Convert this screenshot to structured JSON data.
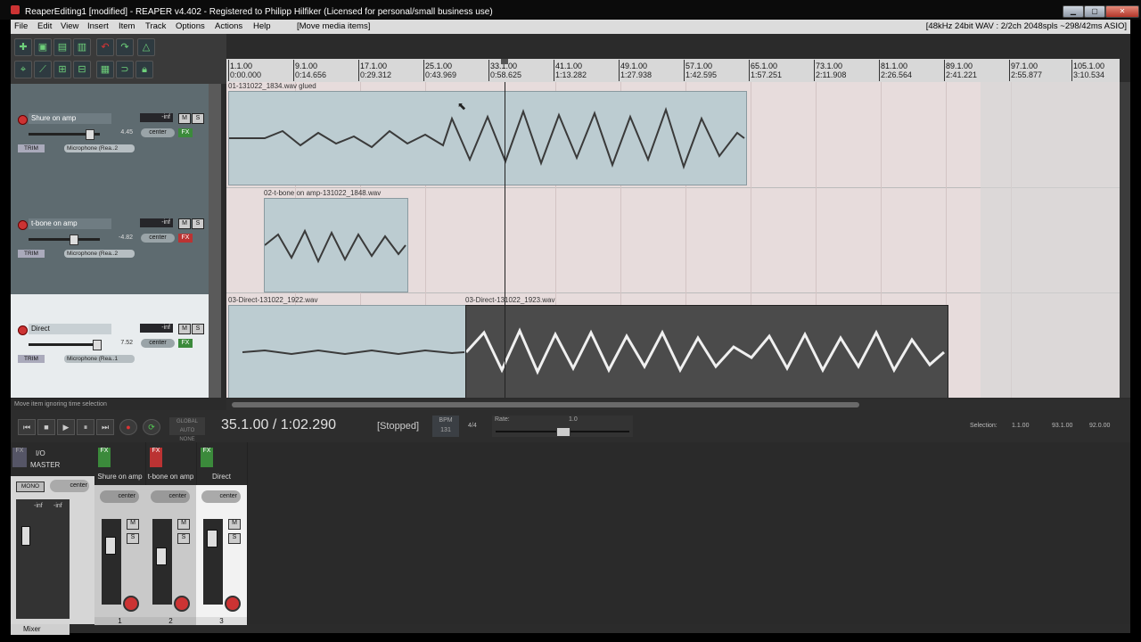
{
  "window": {
    "title": "ReaperEditing1 [modified] - REAPER v4.402 - Registered to Philipp Hilfiker (Licensed for personal/small business use)",
    "min_label": "▁",
    "max_label": "▢",
    "close_label": "✕"
  },
  "menu": {
    "items": [
      "File",
      "Edit",
      "View",
      "Insert",
      "Item",
      "Track",
      "Options",
      "Actions",
      "Help"
    ],
    "action_hint": "[Move media items]",
    "audio_status": "[48kHz 24bit WAV : 2/2ch 2048spls ~298/42ms ASIO]"
  },
  "ruler": {
    "marks": [
      {
        "bar": "1.1.00",
        "time": "0:00.000"
      },
      {
        "bar": "9.1.00",
        "time": "0:14.656"
      },
      {
        "bar": "17.1.00",
        "time": "0:29.312"
      },
      {
        "bar": "25.1.00",
        "time": "0:43.969"
      },
      {
        "bar": "33.1.00",
        "time": "0:58.625"
      },
      {
        "bar": "41.1.00",
        "time": "1:13.282"
      },
      {
        "bar": "49.1.00",
        "time": "1:27.938"
      },
      {
        "bar": "57.1.00",
        "time": "1:42.595"
      },
      {
        "bar": "65.1.00",
        "time": "1:57.251"
      },
      {
        "bar": "73.1.00",
        "time": "2:11.908"
      },
      {
        "bar": "81.1.00",
        "time": "2:26.564"
      },
      {
        "bar": "89.1.00",
        "time": "2:41.221"
      },
      {
        "bar": "97.1.00",
        "time": "2:55.877"
      },
      {
        "bar": "105.1.00",
        "time": "3:10.534"
      }
    ]
  },
  "tracks": [
    {
      "name": "Shure on amp",
      "num": "1",
      "vol": "-inf",
      "vol_db": "4.45",
      "pan": "center",
      "input": "Microphone (Rea..2",
      "io": "I/O",
      "mute": "M",
      "solo": "S",
      "fx": "FX",
      "trim": "TRIM",
      "master": "MASTER"
    },
    {
      "name": "t-bone on amp",
      "num": "2",
      "vol": "-inf",
      "vol_db": "-4.82",
      "pan": "center",
      "input": "Microphone (Rea..2",
      "io": "I/O",
      "mute": "M",
      "solo": "S",
      "fx": "FX",
      "trim": "TRIM",
      "master": "MASTER"
    },
    {
      "name": "Direct",
      "num": "3",
      "vol": "-inf",
      "vol_db": "7.52",
      "pan": "center",
      "input": "Microphone (Rea..1",
      "io": "I/O",
      "mute": "M",
      "solo": "S",
      "fx": "FX",
      "trim": "TRIM",
      "master": "MASTER"
    }
  ],
  "items": [
    {
      "label": "01-131022_1834.wav glued"
    },
    {
      "label": "02-t-bone on amp-131022_1848.wav"
    },
    {
      "label": "03-Direct-131022_1922.wav"
    },
    {
      "label": "03-Direct-131022_1923.wav"
    }
  ],
  "status_hint": "Move item ignoring time selection",
  "transport": {
    "position": "35.1.00 / 1:02.290",
    "state": "[Stopped]",
    "bpm_label": "BPM",
    "bpm": "131",
    "timesig": "4/4",
    "global_auto_label": "GLOBAL AUTO",
    "global_auto_value": "NONE",
    "rate_label": "Rate:",
    "rate": "1.0",
    "selection_label": "Selection:",
    "sel_start": "1.1.00",
    "sel_end": "93.1.00",
    "sel_len": "92.0.00",
    "rate_pct": 50
  },
  "mixer": {
    "master_name": "MASTER",
    "master_io": "I/O",
    "mono": "MONO",
    "center": "center",
    "meter_left": "-inf",
    "meter_right": "-inf",
    "strips": [
      {
        "name": "Shure on amp",
        "num": "1"
      },
      {
        "name": "t-bone on amp",
        "num": "2"
      },
      {
        "name": "Direct",
        "num": "3"
      }
    ],
    "tab": "Mixer"
  }
}
